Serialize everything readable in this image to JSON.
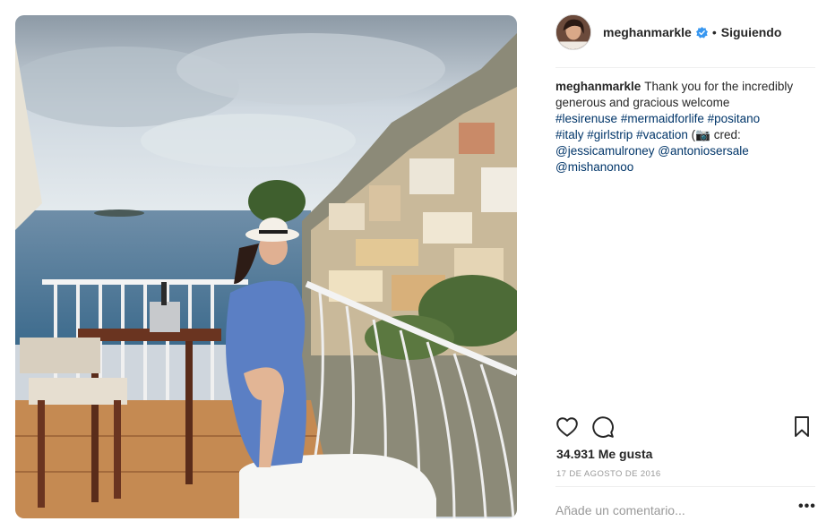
{
  "post": {
    "photo_alt": "Woman in a blue dress seated on a balcony overlooking Positano"
  },
  "header": {
    "username": "meghanmarkle",
    "separator": "•",
    "follow_label": "Siguiendo",
    "verified_color": "#3897f0"
  },
  "caption": {
    "author": "meghanmarkle",
    "text": "Thank you for the incredibly generous and gracious welcome",
    "hashtags": [
      "#lesirenuse",
      "#mermaidforlife",
      "#positano",
      "#italy",
      "#girlstrip",
      "#vacation"
    ],
    "cred_prefix": "(",
    "camera_emoji": "📷",
    "cred_label": "cred:",
    "mentions": [
      "@jessicamulroney",
      "@antoniosersale",
      "@mishanonoo"
    ],
    "link_color": "#003569"
  },
  "actions": {
    "like_icon": "heart-icon",
    "comment_icon": "comment-icon",
    "save_icon": "bookmark-icon"
  },
  "stats": {
    "likes": "34.931 Me gusta",
    "date": "17 DE AGOSTO DE 2016"
  },
  "comment": {
    "placeholder": "Añade un comentario...",
    "more_label": "•••"
  }
}
